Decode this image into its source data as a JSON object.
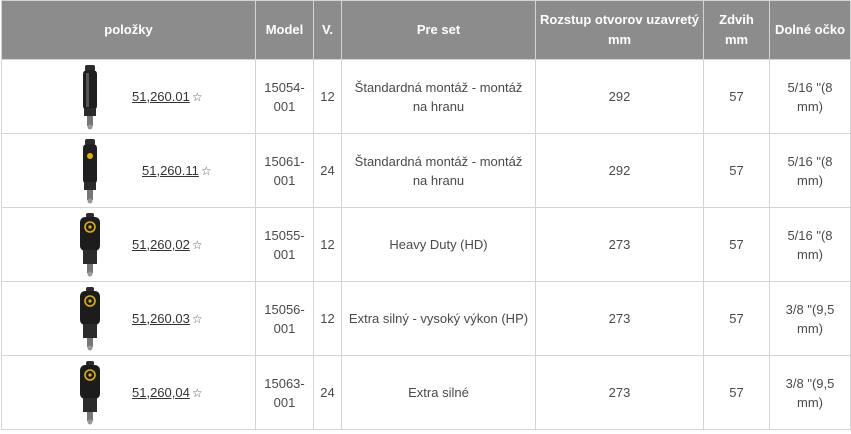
{
  "columns": {
    "item": "položky",
    "model": "Model",
    "voltage": "V.",
    "set": "Pre set",
    "spacing": "Rozstup otvorov uzavretý mm",
    "stroke": "Zdvih mm",
    "eye": "Dolné očko"
  },
  "rows": [
    {
      "code": "51,260.01",
      "star": "☆",
      "model": "15054-001",
      "voltage": "12",
      "set": "Štandardná montáž - montáž na hranu",
      "spacing": "292",
      "stroke": "57",
      "eye": "5/16 \"(8 mm)",
      "icon": "actuator-slim-icon"
    },
    {
      "code": "51,260.11",
      "star": "☆",
      "model": "15061-001",
      "voltage": "24",
      "set": "Štandardná montáž - montáž na hranu",
      "spacing": "292",
      "stroke": "57",
      "eye": "5/16 \"(8 mm)",
      "icon": "actuator-slim-icon"
    },
    {
      "code": "51,260,02",
      "star": "☆",
      "model": "15055-001",
      "voltage": "12",
      "set": "Heavy Duty (HD)",
      "spacing": "273",
      "stroke": "57",
      "eye": "5/16 \"(8 mm)",
      "icon": "actuator-heavy-icon"
    },
    {
      "code": "51,260.03",
      "star": "☆",
      "model": "15056-001",
      "voltage": "12",
      "set": "Extra silný - vysoký výkon (HP)",
      "spacing": "273",
      "stroke": "57",
      "eye": "3/8 \"(9,5 mm)",
      "icon": "actuator-heavy-icon"
    },
    {
      "code": "51,260,04",
      "star": "☆",
      "model": "15063-001",
      "voltage": "24",
      "set": "Extra silné",
      "spacing": "273",
      "stroke": "57",
      "eye": "3/8 \"(9,5 mm)",
      "icon": "actuator-heavy-icon"
    }
  ],
  "colors": {
    "header_bg": "#8c8c8c",
    "header_text": "#ffffff",
    "cell_text": "#4a4a4a",
    "border": "#d4d4d4",
    "logo_yellow": "#e0b400"
  }
}
